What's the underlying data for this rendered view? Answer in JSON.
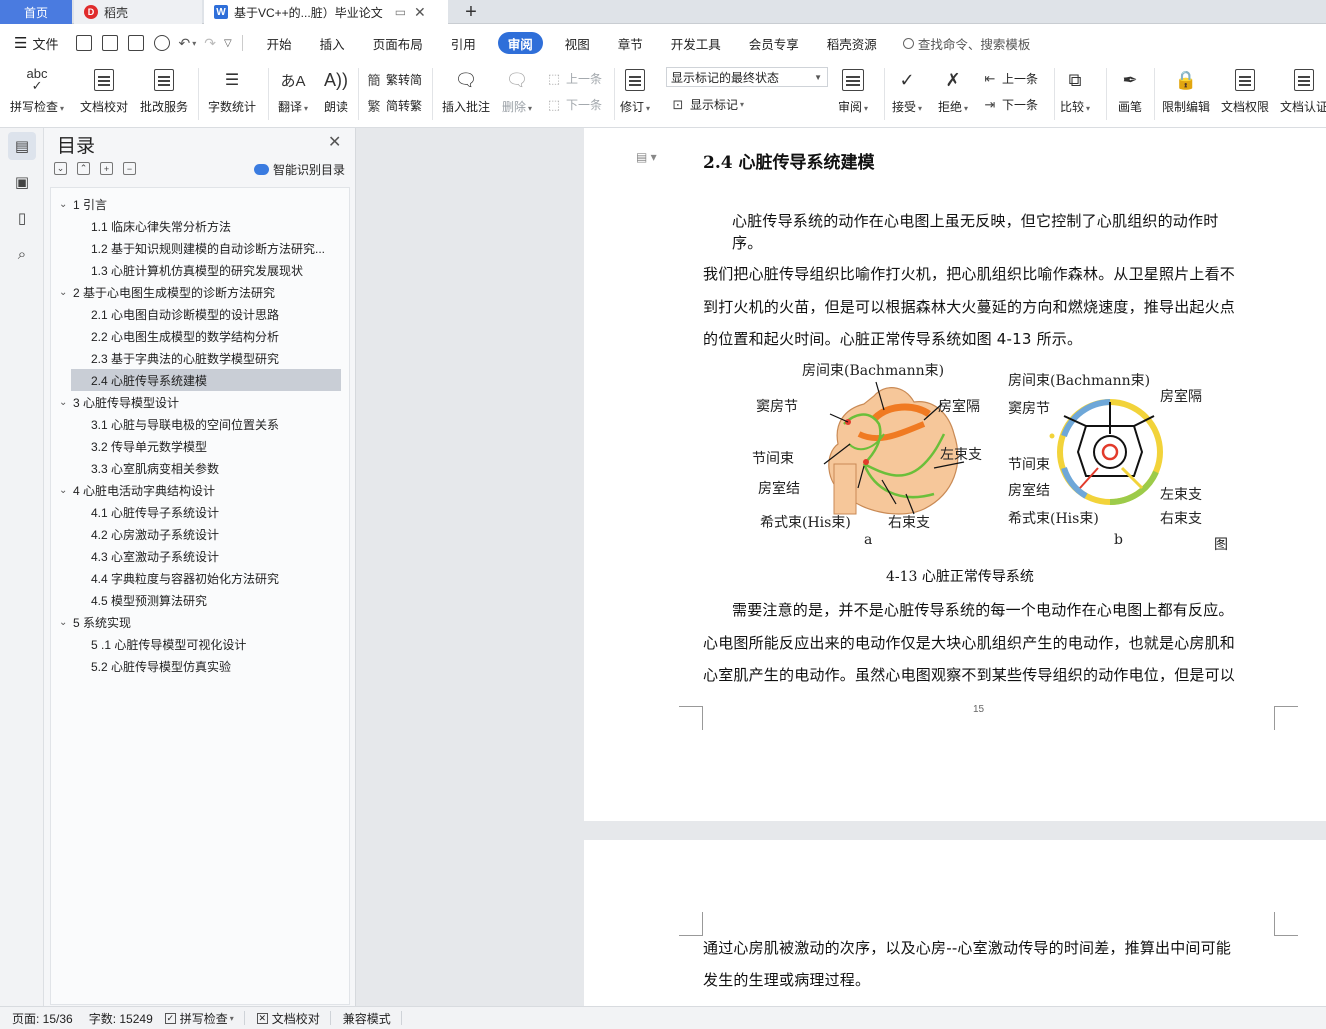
{
  "tabs": {
    "home": "首页",
    "docer": "稻壳",
    "doc": "基于VC++的...脏）毕业论文",
    "new_tab": "+"
  },
  "menu": {
    "file": "文件",
    "items": [
      "开始",
      "插入",
      "页面布局",
      "引用",
      "审阅",
      "视图",
      "章节",
      "开发工具",
      "会员专享",
      "稻壳资源"
    ],
    "active": "审阅",
    "search_placeholder": "查找命令、搜索模板"
  },
  "ribbon": {
    "spell_check": "拼写检查",
    "doc_proof": "文档校对",
    "batch_service": "批改服务",
    "word_count": "字数统计",
    "translate": "翻译",
    "read_aloud": "朗读",
    "to_traditional": "繁转简",
    "to_simplified": "简转繁",
    "insert_comment": "插入批注",
    "delete": "删除",
    "prev": "上一条",
    "next": "下一条",
    "revise": "修订",
    "markup_state": "显示标记的最终状态",
    "show_markup": "显示标记",
    "review": "审阅",
    "accept": "接受",
    "reject": "拒绝",
    "prev2": "上一条",
    "next2": "下一条",
    "compare": "比较",
    "pen": "画笔",
    "restrict_edit": "限制编辑",
    "doc_rights": "文档权限",
    "doc_auth": "文档认证",
    "abc": "abc"
  },
  "toc": {
    "title": "目录",
    "smart": "智能识别目录",
    "items": [
      {
        "text": "1 引言",
        "level": 1
      },
      {
        "text": "1.1 临床心律失常分析方法",
        "level": 2
      },
      {
        "text": "1.2 基于知识规则建模的自动诊断方法研究...",
        "level": 2
      },
      {
        "text": "1.3 心脏计算机仿真模型的研究发展现状",
        "level": 2
      },
      {
        "text": "2 基于心电图生成模型的诊断方法研究",
        "level": 1
      },
      {
        "text": "2.1 心电图自动诊断模型的设计思路",
        "level": 2
      },
      {
        "text": "2.2 心电图生成模型的数学结构分析",
        "level": 2
      },
      {
        "text": "2.3 基于字典法的心脏数学模型研究",
        "level": 2
      },
      {
        "text": "2.4 心脏传导系统建模",
        "level": 2,
        "selected": true
      },
      {
        "text": "3 心脏传导模型设计",
        "level": 1
      },
      {
        "text": "3.1 心脏与导联电极的空间位置关系",
        "level": 2
      },
      {
        "text": "3.2 传导单元数学模型",
        "level": 2
      },
      {
        "text": "3.3 心室肌病变相关参数",
        "level": 2
      },
      {
        "text": "4 心脏电活动字典结构设计",
        "level": 1
      },
      {
        "text": "4.1 心脏传导子系统设计",
        "level": 2
      },
      {
        "text": "4.2 心房激动子系统设计",
        "level": 2
      },
      {
        "text": "4.3 心室激动子系统设计",
        "level": 2
      },
      {
        "text": "4.4 字典粒度与容器初始化方法研究",
        "level": 2
      },
      {
        "text": "4.5 模型预测算法研究",
        "level": 2
      },
      {
        "text": "5 系统实现",
        "level": 1
      },
      {
        "text": "5 .1 心脏传导模型可视化设计",
        "level": 2
      },
      {
        "text": "5.2 心脏传导模型仿真实验",
        "level": 2
      }
    ]
  },
  "document": {
    "heading": "2.4 心脏传导系统建模",
    "lines": [
      "心脏传导系统的动作在心电图上虽无反映，但它控制了心肌组织的动作时",
      "序。",
      "我们把心脏传导组织比喻作打火机，把心肌组织比喻作森林。从卫星照片上看不",
      "到打火机的火苗，但是可以根据森林大火蔓延的方向和燃烧速度，推导出起火点",
      "的位置和起火时间。心脏正常传导系统如图  4-13 所示。",
      "需要注意的是，并不是心脏传导系统的每一个电动作在心电图上都有反应。",
      "心电图所能反应出来的电动作仅是大块心肌组织产生的电动作，也就是心房肌和",
      "心室肌产生的电动作。虽然心电图观察不到某些传导组织的动作电位，但是可以"
    ],
    "page_number": "15",
    "page2_lines": [
      "通过心房肌被激动的次序，以及心房--心室激动传导的时间差，推算出中间可能",
      "发生的生理或病理过程。"
    ],
    "figure": {
      "a_labels": [
        "房间束(Bachmann束)",
        "窦房节",
        "房室隔",
        "节间束",
        "左束支",
        "房室结",
        "希式束(His束)",
        "右束支"
      ],
      "b_labels": [
        "房间束(Bachmann束)",
        "窦房节",
        "房室隔",
        "节间束",
        "房室结",
        "左束支",
        "希式束(His束)",
        "右束支"
      ],
      "sub_a": "a",
      "sub_b": "b",
      "tu": "图",
      "caption": "4-13 心脏正常传导系统"
    }
  },
  "status": {
    "page": "页面: 15/36",
    "words": "字数: 15249",
    "spell": "拼写检查",
    "proof": "文档校对",
    "compat": "兼容模式"
  }
}
